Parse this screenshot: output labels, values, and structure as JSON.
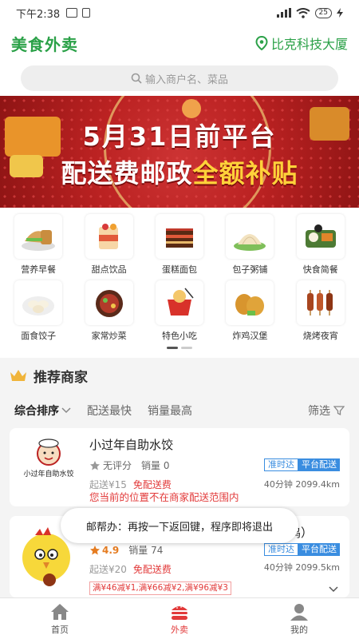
{
  "status_bar": {
    "time": "下午2:38",
    "battery": "25"
  },
  "header": {
    "app_title": "美食外卖",
    "location": "比克科技大厦"
  },
  "search": {
    "placeholder": "输入商户名、菜品"
  },
  "banner": {
    "line1": "5月31日前平台",
    "line2_prefix": "配送费邮政",
    "line2_highlight": "全额补贴"
  },
  "categories": [
    {
      "label": "营养早餐",
      "icon": "breakfast-icon"
    },
    {
      "label": "甜点饮品",
      "icon": "dessert-icon"
    },
    {
      "label": "蛋糕面包",
      "icon": "cake-icon"
    },
    {
      "label": "包子粥铺",
      "icon": "bun-icon"
    },
    {
      "label": "快食简餐",
      "icon": "fastfood-icon"
    },
    {
      "label": "面食饺子",
      "icon": "dumpling-icon"
    },
    {
      "label": "家常炒菜",
      "icon": "stirfry-icon"
    },
    {
      "label": "特色小吃",
      "icon": "snack-icon"
    },
    {
      "label": "炸鸡汉堡",
      "icon": "friedchicken-icon"
    },
    {
      "label": "烧烤夜宵",
      "icon": "bbq-icon"
    }
  ],
  "recommend": {
    "title": "推荐商家"
  },
  "sort": {
    "active": "综合排序",
    "fastest": "配送最快",
    "top_sales": "销量最高",
    "filter": "筛选"
  },
  "merchants": [
    {
      "name": "小过年自助水饺",
      "logo_text": "小过年自助水饺",
      "rating": "无评分",
      "sales": "销量 0",
      "min_order": "起送¥15",
      "delivery": "免配送费",
      "badge_on_time": "准时达",
      "badge_platform": "平台配送",
      "eta": "40分钟 2099.4km",
      "warning": "您当前的位置不在商家配送范围内"
    },
    {
      "name_suffix": "鸣）",
      "rating": "4.9",
      "sales": "销量 74",
      "min_order": "起送¥20",
      "delivery": "免配送费",
      "badge_on_time": "准时达",
      "badge_platform": "平台配送",
      "eta": "40分钟 2099.5km",
      "promo": "满¥46减¥1,满¥66减¥2,满¥96减¥3"
    }
  ],
  "toast": "邮帮办：再按一下返回键，程序即将退出",
  "tabbar": [
    {
      "label": "首页",
      "icon": "home-icon"
    },
    {
      "label": "外卖",
      "icon": "burger-icon"
    },
    {
      "label": "我的",
      "icon": "user-icon"
    }
  ],
  "colors": {
    "brand": "#2ba148",
    "accent": "#e23a3a",
    "badge": "#3a8de0"
  }
}
